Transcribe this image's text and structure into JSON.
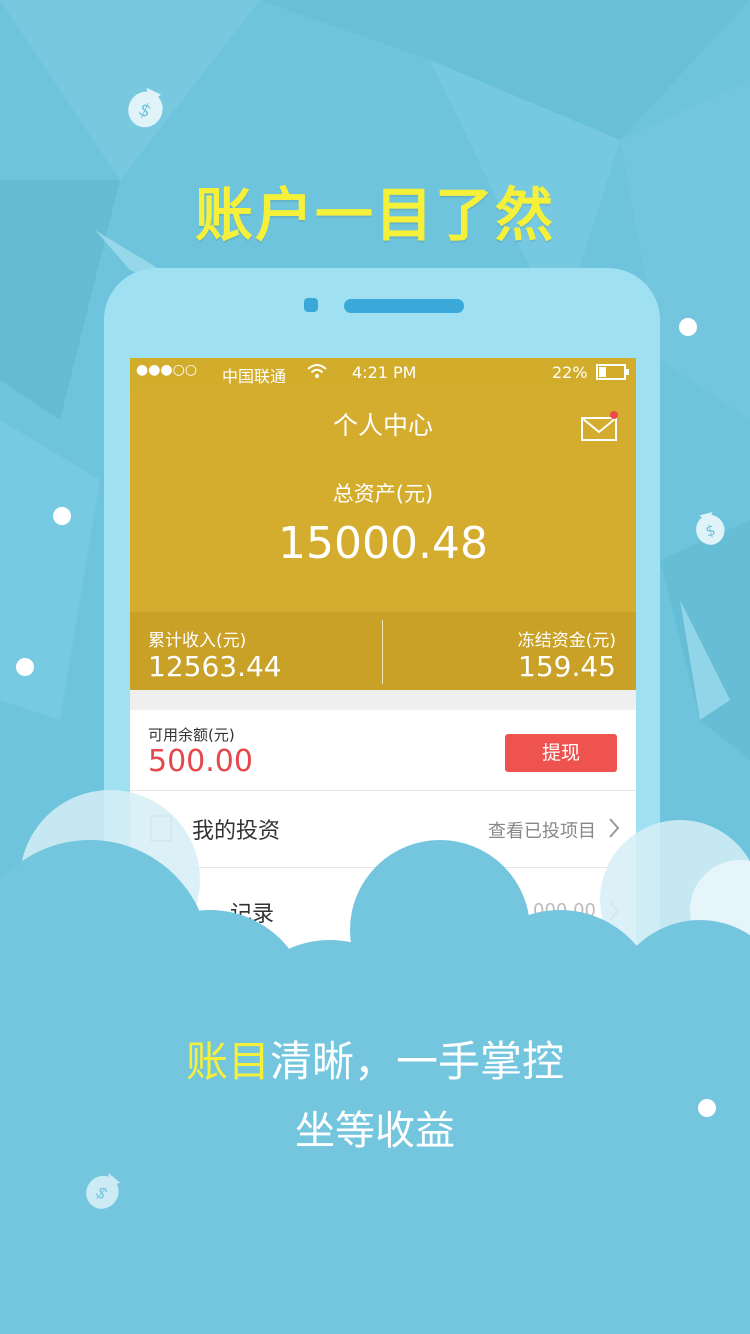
{
  "headline": "账户一目了然",
  "status_bar": {
    "signal": "●●●○○",
    "carrier": "中国联通",
    "time": "4:21 PM",
    "battery": "22%"
  },
  "header": {
    "title": "个人中心",
    "mail_icon": "mail-icon"
  },
  "assets": {
    "total_label": "总资产(元)",
    "total_value": "15000.48",
    "income_label": "累计收入(元)",
    "income_value": "12563.44",
    "frozen_label": "冻结资金(元)",
    "frozen_value": "159.45"
  },
  "balance": {
    "label": "可用余额(元)",
    "value": "500.00",
    "withdraw_label": "提现"
  },
  "rows": [
    {
      "label": "我的投资",
      "right": "查看已投项目"
    },
    {
      "label": "记录",
      "right": "000.00"
    }
  ],
  "slogan": {
    "highlight": "账目",
    "rest": "清晰，一手掌控",
    "line2": "坐等收益"
  },
  "colors": {
    "background": "#6ec4dc",
    "gold": "#d4ad2e",
    "accent_yellow": "#f5f03a",
    "withdraw_red": "#ef5350"
  }
}
